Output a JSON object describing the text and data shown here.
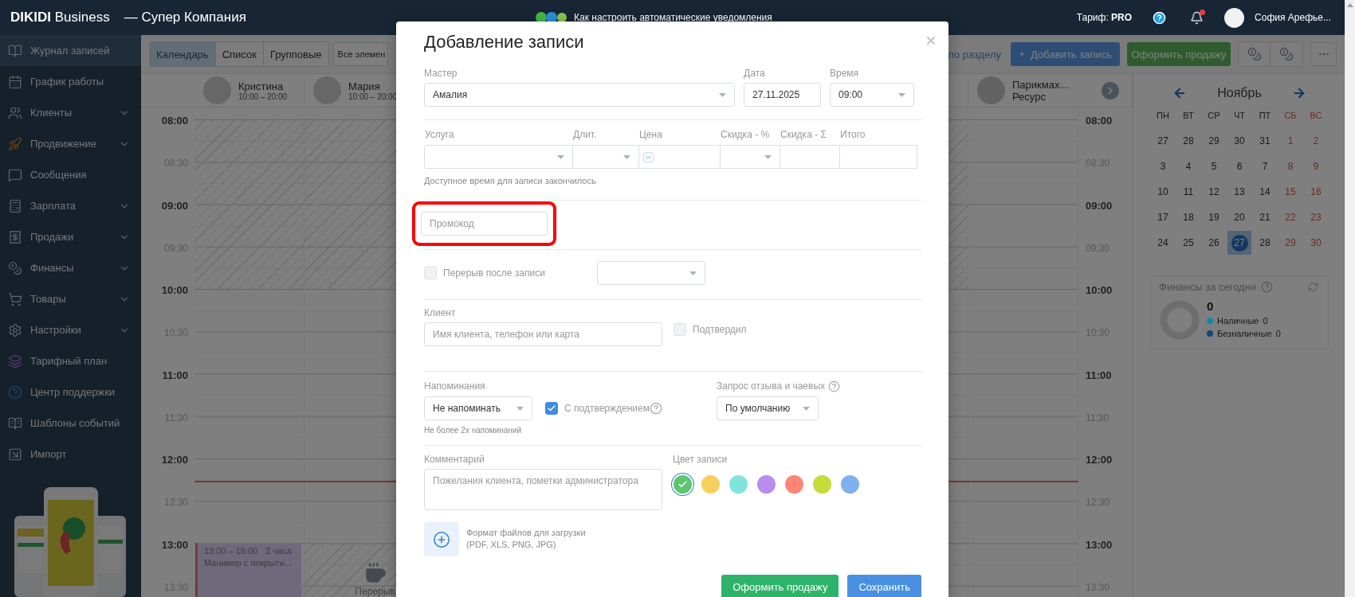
{
  "header": {
    "brand": "**DIKIDI** Business",
    "company": "— Супер Компания",
    "notice": "Как настроить автоматические уведомления",
    "plan": "Тариф: **PRO**",
    "unread": true,
    "user": "София Арефье..."
  },
  "sidebar": {
    "items": [
      {
        "label": "Журнал записей",
        "kind": "journal",
        "selected": true,
        "expandable": false
      },
      {
        "label": "График работы",
        "kind": "schedule",
        "selected": false,
        "expandable": false
      },
      {
        "label": "Клиенты",
        "kind": "clients",
        "selected": false,
        "expandable": true
      },
      {
        "label": "Продвижение",
        "kind": "promotion",
        "selected": false,
        "expandable": true
      },
      {
        "label": "Сообщения",
        "kind": "messages",
        "selected": false,
        "expandable": false
      },
      {
        "label": "Зарплата",
        "kind": "salary",
        "selected": false,
        "expandable": true
      },
      {
        "label": "Продажи",
        "kind": "sales",
        "selected": false,
        "expandable": true
      },
      {
        "label": "Финансы",
        "kind": "finance",
        "selected": false,
        "expandable": true
      },
      {
        "label": "Товары",
        "kind": "goods",
        "selected": false,
        "expandable": true
      },
      {
        "label": "Настройки",
        "kind": "settings",
        "selected": false,
        "expandable": true
      },
      {
        "label": "Тарифный план",
        "kind": "plan",
        "selected": false,
        "expandable": false
      },
      {
        "label": "Центр поддержки",
        "kind": "support",
        "selected": false,
        "expandable": false
      },
      {
        "label": "Шаблоны событий",
        "kind": "templates",
        "selected": false,
        "expandable": false
      },
      {
        "label": "Импорт",
        "kind": "import",
        "selected": false,
        "expandable": false
      }
    ]
  },
  "toolbar": {
    "tabs": [
      {
        "label": "Календарь",
        "selected": true
      },
      {
        "label": "Список",
        "selected": false
      },
      {
        "label": "Групповые",
        "selected": false
      }
    ],
    "filter": "Все элемен",
    "section_link": "по разделу",
    "add_button": "Добавить запись",
    "sell_button": "Оформить продажу"
  },
  "calendar": {
    "staff": [
      {
        "name": "Кристина",
        "hours": "10:00 – 20:00"
      },
      {
        "name": "Мария",
        "hours": "10:00 – 20:00"
      }
    ],
    "resource": {
      "name": "Парикмах...",
      "subtitle": "Ресурс"
    },
    "times_left": [
      {
        "label": "08:00",
        "kind": "hour"
      },
      {
        "label": "08:30",
        "kind": "half"
      },
      {
        "label": "09:00",
        "kind": "hour"
      },
      {
        "label": "09:30",
        "kind": "half"
      },
      {
        "label": "10:00",
        "kind": "hour"
      },
      {
        "label": "10:30",
        "kind": "half"
      },
      {
        "label": "11:00",
        "kind": "hour"
      },
      {
        "label": "11:30",
        "kind": "half"
      },
      {
        "label": "12:00",
        "kind": "hour"
      },
      {
        "label": "12:30",
        "kind": "half"
      },
      {
        "label": "13:00",
        "kind": "hour"
      },
      {
        "label": "13:30",
        "kind": "half"
      }
    ],
    "times_right": [
      {
        "label": "08:00",
        "kind": "hour"
      },
      {
        "label": "08:30",
        "kind": "half"
      },
      {
        "label": "09:00",
        "kind": "hour"
      },
      {
        "label": "09:30",
        "kind": "half"
      },
      {
        "label": "10:00",
        "kind": "hour"
      },
      {
        "label": "10:30",
        "kind": "half"
      },
      {
        "label": "11:00",
        "kind": "hour"
      },
      {
        "label": "11:30",
        "kind": "half"
      },
      {
        "label": "12:00",
        "kind": "hour"
      },
      {
        "label": "12:30",
        "kind": "half"
      },
      {
        "label": "13:00",
        "kind": "hour"
      },
      {
        "label": "13:30",
        "kind": "half"
      }
    ],
    "event": {
      "time": "13:00 – 15:00",
      "duration": "2 часа",
      "title": "Маникюр с покрыти..."
    },
    "break_label": "Перерыв"
  },
  "mini_calendar": {
    "month": "Ноябрь",
    "weekdays": [
      {
        "label": "ПН",
        "weekend": false
      },
      {
        "label": "ВТ",
        "weekend": false
      },
      {
        "label": "СР",
        "weekend": false
      },
      {
        "label": "ЧТ",
        "weekend": false
      },
      {
        "label": "ПТ",
        "weekend": false
      },
      {
        "label": "СБ",
        "weekend": true
      },
      {
        "label": "ВС",
        "weekend": true
      }
    ],
    "weeks": [
      {
        "days": [
          {
            "day": "27",
            "weekend": false,
            "selected": false
          },
          {
            "day": "28",
            "weekend": false,
            "selected": false
          },
          {
            "day": "29",
            "weekend": false,
            "selected": false
          },
          {
            "day": "30",
            "weekend": false,
            "selected": false
          },
          {
            "day": "31",
            "weekend": false,
            "selected": false
          },
          {
            "day": "1",
            "weekend": true,
            "selected": false
          },
          {
            "day": "2",
            "weekend": true,
            "selected": false
          }
        ]
      },
      {
        "days": [
          {
            "day": "3",
            "weekend": false,
            "selected": false
          },
          {
            "day": "4",
            "weekend": false,
            "selected": false
          },
          {
            "day": "5",
            "weekend": false,
            "selected": false
          },
          {
            "day": "6",
            "weekend": false,
            "selected": false
          },
          {
            "day": "7",
            "weekend": false,
            "selected": false
          },
          {
            "day": "8",
            "weekend": true,
            "selected": false
          },
          {
            "day": "9",
            "weekend": true,
            "selected": false
          }
        ]
      },
      {
        "days": [
          {
            "day": "10",
            "weekend": false,
            "selected": false
          },
          {
            "day": "11",
            "weekend": false,
            "selected": false
          },
          {
            "day": "12",
            "weekend": false,
            "selected": false
          },
          {
            "day": "13",
            "weekend": false,
            "selected": false
          },
          {
            "day": "14",
            "weekend": false,
            "selected": false
          },
          {
            "day": "15",
            "weekend": true,
            "selected": false
          },
          {
            "day": "16",
            "weekend": true,
            "selected": false
          }
        ]
      },
      {
        "days": [
          {
            "day": "17",
            "weekend": false,
            "selected": false
          },
          {
            "day": "18",
            "weekend": false,
            "selected": false
          },
          {
            "day": "19",
            "weekend": false,
            "selected": false
          },
          {
            "day": "20",
            "weekend": false,
            "selected": false
          },
          {
            "day": "21",
            "weekend": false,
            "selected": false
          },
          {
            "day": "22",
            "weekend": true,
            "selected": false
          },
          {
            "day": "23",
            "weekend": true,
            "selected": false
          }
        ]
      },
      {
        "days": [
          {
            "day": "24",
            "weekend": false,
            "selected": false
          },
          {
            "day": "25",
            "weekend": false,
            "selected": false
          },
          {
            "day": "26",
            "weekend": false,
            "selected": false
          },
          {
            "day": "27",
            "weekend": false,
            "selected": true
          },
          {
            "day": "28",
            "weekend": false,
            "selected": false
          },
          {
            "day": "29",
            "weekend": true,
            "selected": false
          },
          {
            "day": "30",
            "weekend": true,
            "selected": false
          }
        ]
      }
    ]
  },
  "finance": {
    "title": "Финансы за сегодня",
    "total": "0",
    "legend": [
      {
        "label": "Наличные",
        "value": "0",
        "color": "#1188aa"
      },
      {
        "label": "Безналичные",
        "value": "0",
        "color": "#0a4a80"
      }
    ]
  },
  "modal": {
    "title": "Добавление записи",
    "master": {
      "label": "Мастер",
      "value": "Амалия"
    },
    "date": {
      "label": "Дата",
      "value": "27.11.2025"
    },
    "time": {
      "label": "Время",
      "value": "09:00"
    },
    "service_columns": [
      {
        "label": "Услуга",
        "kind": "select"
      },
      {
        "label": "Длит.",
        "kind": "select"
      },
      {
        "label": "Цена",
        "kind": "price",
        "prefix": "от"
      },
      {
        "label": "Скидка - %",
        "kind": "select"
      },
      {
        "label": "Скидка - Σ",
        "kind": "input"
      },
      {
        "label": "Итого",
        "kind": "input"
      }
    ],
    "service_hint": "Доступное время для записи закончилось",
    "promo": {
      "placeholder": "Промокод",
      "highlighted": true
    },
    "break_after": {
      "label": "Перерыв после записи",
      "checked": false
    },
    "client": {
      "label": "Клиент",
      "placeholder": "Имя клиента, телефон или карта"
    },
    "confirmed": {
      "label": "Подтвердил",
      "checked": false
    },
    "reminders": {
      "label": "Напоминания",
      "value": "Не напоминать",
      "hint": "Не более 2х напоминаний"
    },
    "with_confirmation": {
      "label": "С подтверждением",
      "checked": true
    },
    "review": {
      "label": "Запрос отзыва и чаевых",
      "value": "По умолчанию"
    },
    "comment": {
      "label": "Комментарий",
      "placeholder": "Пожелания клиента, пометки администратора"
    },
    "colors": {
      "label": "Цвет записи",
      "options": [
        {
          "color": "#5ec46e",
          "selected": true
        },
        {
          "color": "#f6cf5e",
          "selected": false
        },
        {
          "color": "#80e4dc",
          "selected": false
        },
        {
          "color": "#b98ced",
          "selected": false
        },
        {
          "color": "#fe8576",
          "selected": false
        },
        {
          "color": "#c3dd3a",
          "selected": false
        },
        {
          "color": "#7fb0f0",
          "selected": false
        }
      ]
    },
    "upload": {
      "text": "Формат файлов для загрузки",
      "formats": "(PDF, XLS, PNG, JPG)"
    },
    "buttons": [
      {
        "label": "Оформить продажу",
        "kind": "sale"
      },
      {
        "label": "Сохранить",
        "kind": "save"
      }
    ]
  }
}
